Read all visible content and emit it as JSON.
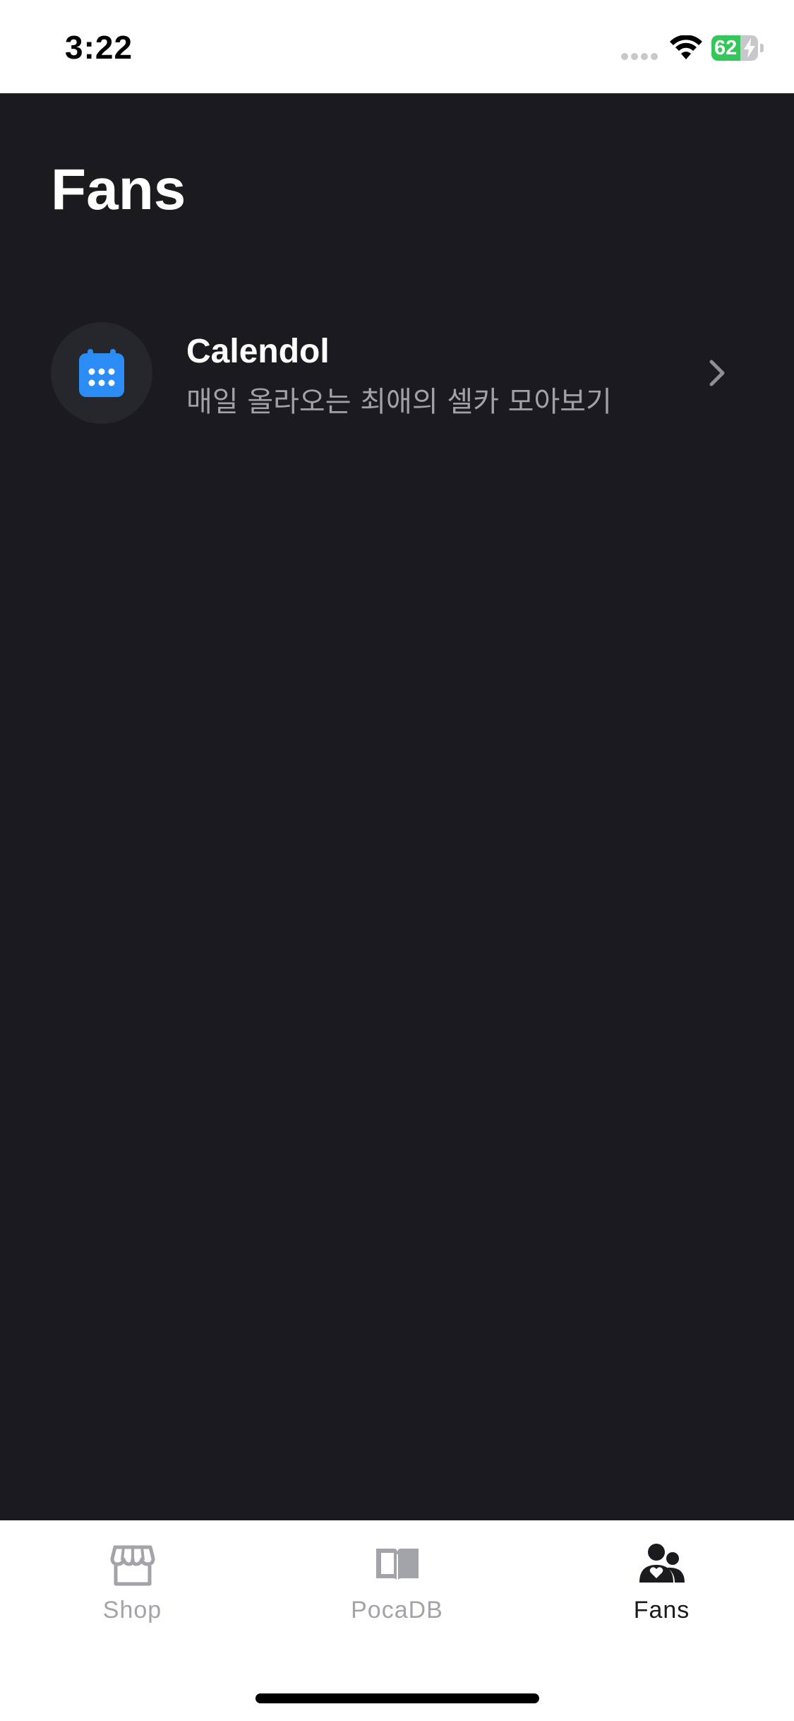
{
  "status_bar": {
    "time": "3:22",
    "battery_level": "62",
    "battery_fraction": 0.62,
    "battery_charging": true,
    "icons": [
      "cellular-icon",
      "wifi-icon",
      "battery-icon",
      "bolt-icon"
    ]
  },
  "header": {
    "title": "Fans"
  },
  "features": [
    {
      "icon": "calendar-icon",
      "title": "Calendol",
      "subtitle": "매일 올라오는 최애의 셀카 모아보기"
    }
  ],
  "tab_bar": {
    "tabs": [
      {
        "label": "Shop",
        "icon": "storefront-icon",
        "active": false
      },
      {
        "label": "PocaDB",
        "icon": "book-icon",
        "active": false
      },
      {
        "label": "Fans",
        "icon": "people-heart-icon",
        "active": true
      }
    ]
  },
  "colors": {
    "background": "#1b1a1f",
    "accent": "#2b8cf5",
    "battery_green": "#34c759",
    "inactive_tab": "#a3a3aa",
    "active_tab": "#1b1a1f"
  }
}
